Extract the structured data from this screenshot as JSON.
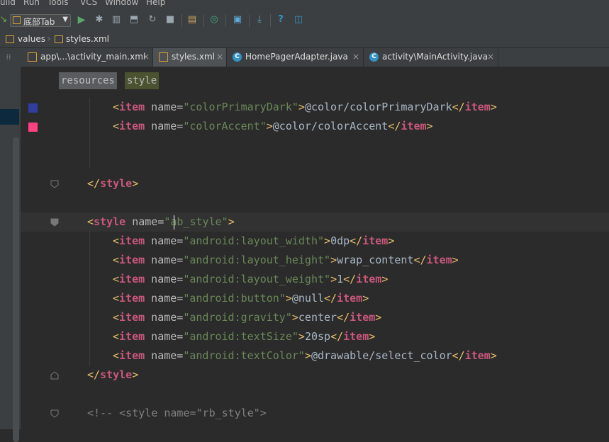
{
  "menubar": {
    "items": [
      "uild",
      "Run",
      "Tools",
      "VCS",
      "Window",
      "Help"
    ]
  },
  "toolbar": {
    "run_config": "底部Tab"
  },
  "breadcrumb": {
    "items": [
      "values",
      "styles.xml"
    ]
  },
  "tabs": [
    {
      "label": "app\\...\\activity_main.xml",
      "type": "xml",
      "active": false
    },
    {
      "label": "styles.xml",
      "type": "xml",
      "active": true
    },
    {
      "label": "HomePagerAdapter.java",
      "type": "class",
      "active": false
    },
    {
      "label": "activity\\MainActivity.java",
      "type": "class",
      "active": false
    }
  ],
  "tab_close_glyph": "×",
  "editor": {
    "crumbs": [
      "resources",
      "style"
    ],
    "gutter_colors": [
      "#303f9f",
      "#ff4081"
    ],
    "lines": [
      {
        "indent": "        ",
        "tag": "item",
        "attr": "name",
        "value": "colorPrimaryDark",
        "text": "@color/colorPrimaryDark"
      },
      {
        "indent": "        ",
        "tag": "item",
        "attr": "name",
        "value": "colorAccent",
        "text": "@color/colorAccent"
      },
      {
        "close": "style"
      },
      {
        "open": "style",
        "attr": "name",
        "value": "ab_style"
      },
      {
        "indent": "        ",
        "tag": "item",
        "attr": "name",
        "value": "android:layout_width",
        "text": "0dp"
      },
      {
        "indent": "        ",
        "tag": "item",
        "attr": "name",
        "value": "android:layout_height",
        "text": "wrap_content"
      },
      {
        "indent": "        ",
        "tag": "item",
        "attr": "name",
        "value": "android:layout_weight",
        "text": "1"
      },
      {
        "indent": "        ",
        "tag": "item",
        "attr": "name",
        "value": "android:button",
        "text": "@null"
      },
      {
        "indent": "        ",
        "tag": "item",
        "attr": "name",
        "value": "android:gravity",
        "text": "center"
      },
      {
        "indent": "        ",
        "tag": "item",
        "attr": "name",
        "value": "android:textSize",
        "text": "20sp"
      },
      {
        "indent": "        ",
        "tag": "item",
        "attr": "name",
        "value": "android:textColor",
        "text": "@drawable/select_color"
      },
      {
        "close": "style"
      },
      {
        "comment": "<!-- <style name=\"rb_style\">"
      }
    ]
  }
}
